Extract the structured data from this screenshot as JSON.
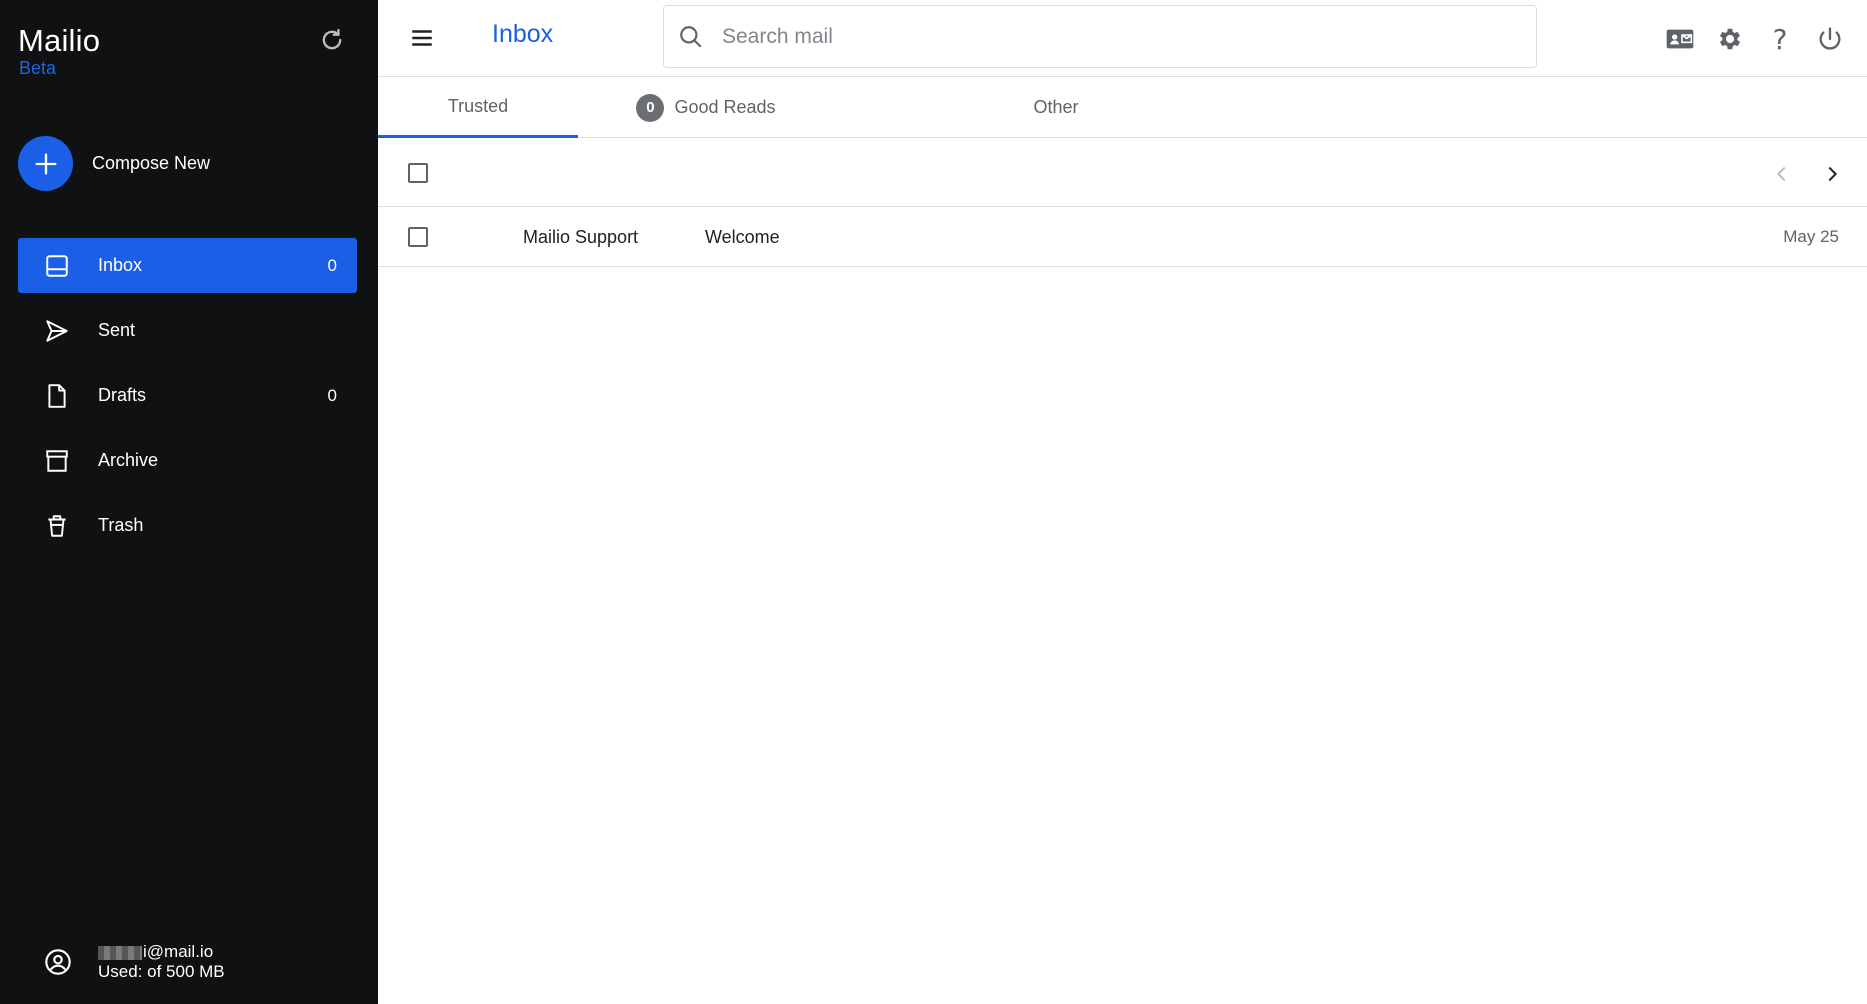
{
  "brand": {
    "name": "Mailio",
    "tag": "Beta"
  },
  "compose": {
    "label": "Compose New"
  },
  "sidebar": {
    "items": [
      {
        "label": "Inbox",
        "count": "0",
        "icon": "inbox-icon",
        "active": true
      },
      {
        "label": "Sent",
        "count": "",
        "icon": "send-icon"
      },
      {
        "label": "Drafts",
        "count": "0",
        "icon": "draft-icon"
      },
      {
        "label": "Archive",
        "count": "",
        "icon": "archive-icon"
      },
      {
        "label": "Trash",
        "count": "",
        "icon": "trash-icon"
      }
    ]
  },
  "account": {
    "email": "i@mail.io",
    "usage": "Used: of 500 MB"
  },
  "header": {
    "title": "Inbox"
  },
  "search": {
    "placeholder": "Search mail"
  },
  "tabs": [
    {
      "label": "Trusted",
      "active": true
    },
    {
      "label": "Good Reads",
      "badge": "0"
    },
    {
      "label": "Other"
    }
  ],
  "messages": [
    {
      "from": "Mailio Support",
      "subject": "Welcome",
      "date": "May 25"
    }
  ],
  "colors": {
    "accent": "#1a5fe6",
    "sidebar_bg": "#101113",
    "beta": "#1a66e8"
  }
}
